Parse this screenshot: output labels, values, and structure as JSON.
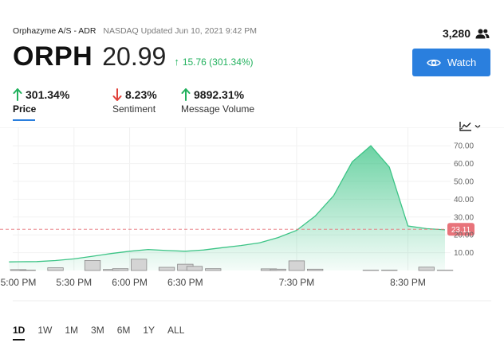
{
  "header": {
    "company": "Orphazyme A/S - ADR",
    "exchange_info": "NASDAQ Updated Jun 10, 2021 9:42 PM",
    "symbol": "ORPH",
    "price": "20.99",
    "change": "15.76 (301.34%)",
    "watchers": "3,280",
    "watch_label": "Watch"
  },
  "metrics": {
    "price": {
      "value": "301.34%",
      "label": "Price",
      "direction": "up"
    },
    "sentiment": {
      "value": "8.23%",
      "label": "Sentiment",
      "direction": "down"
    },
    "volume": {
      "value": "9892.31%",
      "label": "Message Volume",
      "direction": "up"
    }
  },
  "colors": {
    "accent": "#2a7fde",
    "up": "#21b15d",
    "down": "#e0413a",
    "line": "#3cc486",
    "bar_fill": "#d4d4d4",
    "bar_stroke": "#8a8a8a",
    "price_label": "#e8737a"
  },
  "chart_data": {
    "type": "area",
    "x": [
      "4:55 PM",
      "5:00 PM",
      "5:10 PM",
      "5:20 PM",
      "5:30 PM",
      "5:40 PM",
      "5:50 PM",
      "6:00 PM",
      "6:10 PM",
      "6:20 PM",
      "6:30 PM",
      "6:40 PM",
      "6:50 PM",
      "7:00 PM",
      "7:10 PM",
      "7:20 PM",
      "7:30 PM",
      "7:40 PM",
      "7:50 PM",
      "8:00 PM",
      "8:10 PM",
      "8:20 PM",
      "8:30 PM",
      "8:40 PM",
      "8:50 PM"
    ],
    "series": [
      {
        "values": [
          4.8,
          4.9,
          5.0,
          5.6,
          6.5,
          8.0,
          9.5,
          10.8,
          11.8,
          11.2,
          10.8,
          11.5,
          12.8,
          14.0,
          15.5,
          18.5,
          22.5,
          30.5,
          42.0,
          61.0,
          70.0,
          58.0,
          25.0,
          23.5,
          22.8
        ]
      }
    ],
    "volume_bars": [
      {
        "x": "5:00 PM",
        "value": 1.0
      },
      {
        "x": "5:05 PM",
        "value": 0.5
      },
      {
        "x": "5:20 PM",
        "value": 3.2
      },
      {
        "x": "5:40 PM",
        "value": 12.0
      },
      {
        "x": "5:50 PM",
        "value": 1.2
      },
      {
        "x": "5:55 PM",
        "value": 2.2
      },
      {
        "x": "6:05 PM",
        "value": 13.5
      },
      {
        "x": "6:20 PM",
        "value": 3.8
      },
      {
        "x": "6:30 PM",
        "value": 7.5
      },
      {
        "x": "6:35 PM",
        "value": 5.0
      },
      {
        "x": "6:45 PM",
        "value": 2.2
      },
      {
        "x": "7:15 PM",
        "value": 2.0
      },
      {
        "x": "7:20 PM",
        "value": 1.6
      },
      {
        "x": "7:30 PM",
        "value": 11.5
      },
      {
        "x": "7:40 PM",
        "value": 1.6
      },
      {
        "x": "8:10 PM",
        "value": 0.4
      },
      {
        "x": "8:20 PM",
        "value": 0.5
      },
      {
        "x": "8:40 PM",
        "value": 4.0
      },
      {
        "x": "8:50 PM",
        "value": 0.4
      }
    ],
    "current_price_line": 23.11,
    "current_price_label": "23.11",
    "x_ticks": [
      "5:00 PM",
      "5:30 PM",
      "6:00 PM",
      "6:30 PM",
      "7:30 PM",
      "8:30 PM"
    ],
    "y_ticks": [
      "10.00",
      "20.00",
      "30.00",
      "40.00",
      "50.00",
      "60.00",
      "70.00"
    ],
    "ylim": [
      0,
      75
    ],
    "y_axis_side": "right",
    "grid": true
  },
  "range_tabs": [
    {
      "label": "1D",
      "active": true
    },
    {
      "label": "1W",
      "active": false
    },
    {
      "label": "1M",
      "active": false
    },
    {
      "label": "3M",
      "active": false
    },
    {
      "label": "6M",
      "active": false
    },
    {
      "label": "1Y",
      "active": false
    },
    {
      "label": "ALL",
      "active": false
    }
  ]
}
